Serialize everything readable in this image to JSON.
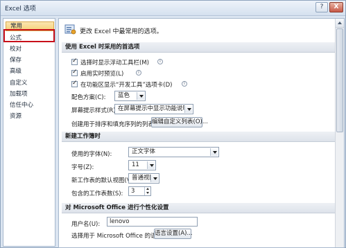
{
  "window": {
    "title": "Excel 选项",
    "help": "?",
    "close": "X"
  },
  "nav": {
    "items": [
      {
        "label": "常用",
        "selected": true
      },
      {
        "label": "公式",
        "selected": false
      },
      {
        "label": "校对",
        "selected": false
      },
      {
        "label": "保存",
        "selected": false
      },
      {
        "label": "高级",
        "selected": false
      },
      {
        "label": "自定义",
        "selected": false
      },
      {
        "label": "加载项",
        "selected": false
      },
      {
        "label": "信任中心",
        "selected": false
      },
      {
        "label": "资源",
        "selected": false
      }
    ],
    "highlight_color": "#c8101a"
  },
  "header": {
    "text": "更改 Excel 中最常用的选项。",
    "icon": "options-icon"
  },
  "sections": {
    "top": {
      "title": "使用 Excel 时采用的首选项",
      "checkboxes": [
        {
          "label": "选择时显示浮动工具栏(M)",
          "checked": true
        },
        {
          "label": "启用实时预览(L)",
          "checked": true
        },
        {
          "label": "在功能区显示“开发工具”选项卡(D)",
          "checked": true
        }
      ],
      "color_scheme": {
        "label": "配色方案(C):",
        "value": "蓝色"
      },
      "tooltip_style": {
        "label": "屏幕提示样式(R):",
        "value": "在屏幕提示中显示功能说明"
      },
      "custom_list": {
        "label": "创建用于排序和填充序列的列表:",
        "button": "编辑自定义列表(O)..."
      }
    },
    "new_workbook": {
      "title": "新建工作簿时",
      "font": {
        "label": "使用的字体(N):",
        "value": "正文字体"
      },
      "font_size": {
        "label": "字号(Z):",
        "value": "11"
      },
      "default_view": {
        "label": "新工作表的默认视图(V):",
        "value": "普通视图"
      },
      "sheet_count": {
        "label": "包含的工作表数(S):",
        "value": "3"
      }
    },
    "personalize": {
      "title": "对 Microsoft Office 进行个性化设置",
      "username": {
        "label": "用户名(U):",
        "value": "lenovo"
      },
      "language": {
        "label": "选择用于 Microsoft Office 的语言:",
        "button": "语言设置(A)..."
      }
    }
  }
}
